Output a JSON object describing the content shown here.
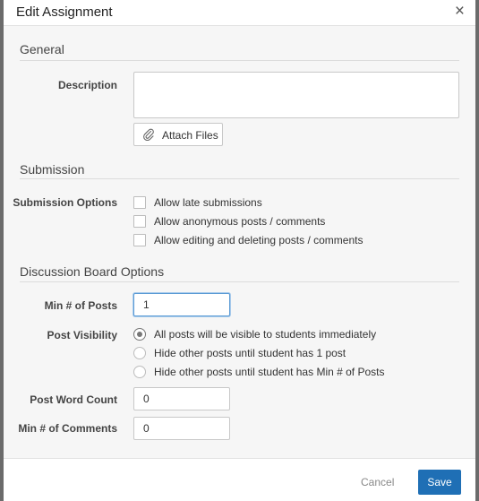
{
  "dialog": {
    "title": "Edit Assignment",
    "close_glyph": "×"
  },
  "general": {
    "section_title": "General",
    "description_label": "Description",
    "description_value": "",
    "attach_label": "Attach Files"
  },
  "submission": {
    "section_title": "Submission",
    "options_label": "Submission Options",
    "options": [
      {
        "label": "Allow late submissions",
        "checked": false
      },
      {
        "label": "Allow anonymous posts / comments",
        "checked": false
      },
      {
        "label": "Allow editing and deleting posts / comments",
        "checked": false
      }
    ]
  },
  "discussion": {
    "section_title": "Discussion Board Options",
    "min_posts_label": "Min # of Posts",
    "min_posts_value": "1",
    "visibility_label": "Post Visibility",
    "visibility_options": [
      {
        "label": "All posts will be visible to students immediately",
        "selected": true
      },
      {
        "label": "Hide other posts until student has 1 post",
        "selected": false
      },
      {
        "label": "Hide other posts until student has Min # of Posts",
        "selected": false
      }
    ],
    "word_count_label": "Post Word Count",
    "word_count_value": "0",
    "min_comments_label": "Min # of Comments",
    "min_comments_value": "0"
  },
  "footer": {
    "cancel_label": "Cancel",
    "save_label": "Save"
  },
  "icons": {
    "close": "close-icon",
    "attach": "paperclip-icon"
  },
  "colors": {
    "primary": "#1f6fb5",
    "focus_border": "#5b9bd5"
  }
}
